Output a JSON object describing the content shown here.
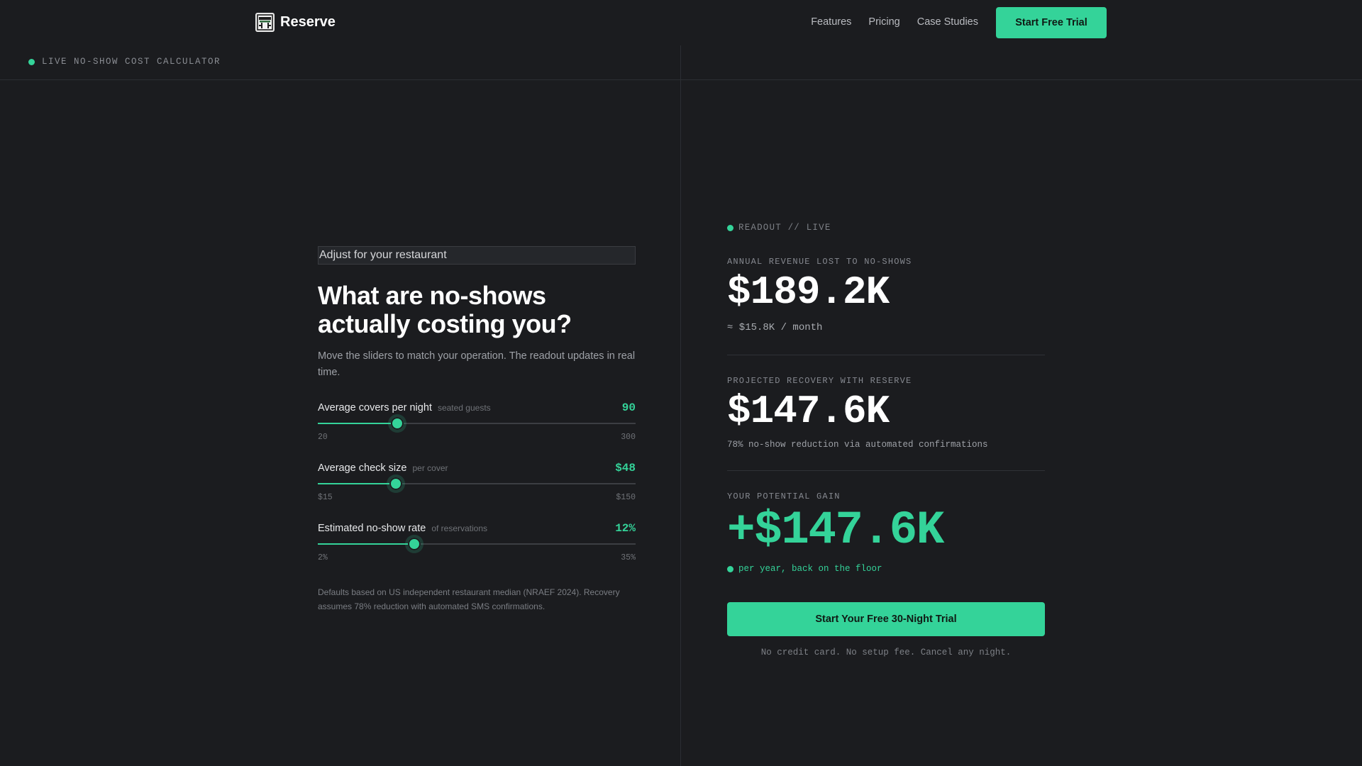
{
  "nav": {
    "brand": "Reserve",
    "logo_icon": "restaurant-table-icon",
    "links": [
      "Features",
      "Pricing",
      "Case Studies"
    ],
    "cta": "Start Free Trial"
  },
  "strip": {
    "label": "LIVE NO-SHOW COST CALCULATOR"
  },
  "left": {
    "eyebrow": "Adjust for your restaurant",
    "headline_line1": "What are no-shows",
    "headline_line2": "actually costing you?",
    "sub": "Move the sliders to match your operation. The readout updates in real time.",
    "sliders": [
      {
        "label": "Average covers per night",
        "hint": "seated guests",
        "value": "90",
        "min_label": "20",
        "max_label": "300",
        "min": 20,
        "max": 300,
        "current": 90
      },
      {
        "label": "Average check size",
        "hint": "per cover",
        "value": "$48",
        "min_label": "$15",
        "max_label": "$150",
        "min": 15,
        "max": 150,
        "current": 48
      },
      {
        "label": "Estimated no-show rate",
        "hint": "of reservations",
        "value": "12%",
        "min_label": "2%",
        "max_label": "35%",
        "min": 2,
        "max": 35,
        "current": 12
      }
    ],
    "footnote": "Defaults based on US independent restaurant median (NRAEF 2024). Recovery assumes 78% reduction with automated SMS confirmations."
  },
  "right": {
    "tag": "READOUT // LIVE",
    "lost_label": "ANNUAL REVENUE LOST TO NO-SHOWS",
    "lost_value": "$189.2K",
    "lost_monthly": "≈ $15.8K / month",
    "recovery_label": "PROJECTED RECOVERY WITH RESERVE",
    "recovery_value": "$147.6K",
    "recovery_note": "78% no-show reduction via automated confirmations",
    "gain_label": "YOUR POTENTIAL GAIN",
    "gain_value": "+$147.6K",
    "gain_note": "per year, back on the floor",
    "cta": "Start Your Free 30-Night Trial",
    "cta_note": "No credit card. No setup fee. Cancel any night."
  },
  "colors": {
    "accent": "#34d399",
    "background": "#1b1c1f"
  }
}
